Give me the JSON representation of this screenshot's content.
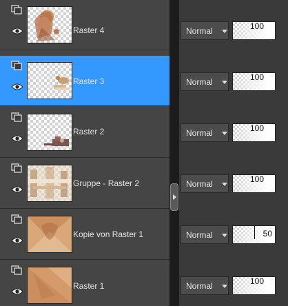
{
  "layers": [
    {
      "name": "Raster 4",
      "blend_mode": "Normal",
      "opacity": "100",
      "selected": false
    },
    {
      "name": "Raster 3",
      "blend_mode": "Normal",
      "opacity": "100",
      "selected": true
    },
    {
      "name": "Raster 2",
      "blend_mode": "Normal",
      "opacity": "100",
      "selected": false
    },
    {
      "name": "Gruppe - Raster 2",
      "blend_mode": "Normal",
      "opacity": "100",
      "selected": false
    },
    {
      "name": "Kopie von Raster 1",
      "blend_mode": "Normal",
      "opacity": "50",
      "selected": false
    },
    {
      "name": "Raster 1",
      "blend_mode": "Normal",
      "opacity": "100",
      "selected": false
    }
  ],
  "icons": {
    "group": "layer-group-icon",
    "visibility": "eye-icon",
    "dropdown": "chevron-down-icon",
    "splitter": "chevron-right-icon"
  },
  "colors": {
    "selection": "#3399ff",
    "panel_bg": "#454545",
    "right_panel_bg": "#3a3a3a"
  }
}
